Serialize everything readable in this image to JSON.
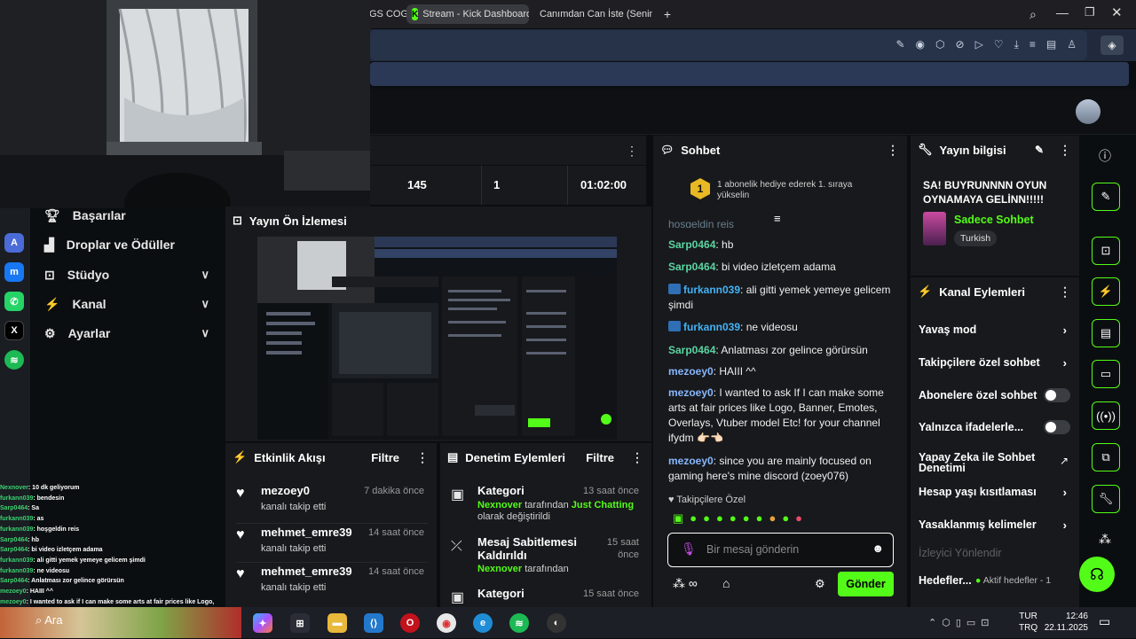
{
  "browser": {
    "tabs": [
      {
        "label": "GS COG"
      },
      {
        "label": "Stream - Kick Dashboard",
        "active": true
      },
      {
        "label": "Canımdan Can İste (Senin"
      }
    ],
    "new_tab": "+"
  },
  "stats": {
    "viewers": "145",
    "count2": "1",
    "duration": "01:02:00"
  },
  "left_nav": {
    "items": [
      {
        "label": "Başarılar",
        "icon": "trophy-icon"
      },
      {
        "label": "Droplar ve Ödüller",
        "icon": "drops-icon"
      },
      {
        "label": "Stüdyo",
        "icon": "studio-icon",
        "chevron": true
      },
      {
        "label": "Kanal",
        "icon": "channel-icon",
        "chevron": true
      },
      {
        "label": "Ayarlar",
        "icon": "gear-icon",
        "chevron": true
      }
    ]
  },
  "overlay_chat": [
    {
      "user": "Nexnover",
      "text": ": 10 dk geliyorum"
    },
    {
      "user": "furkann039",
      "text": ": bendesin"
    },
    {
      "user": "Sarp0464",
      "text": ": Sa"
    },
    {
      "user": "furkann039",
      "text": ": as"
    },
    {
      "user": "furkann039",
      "text": ": hoşgeldin reis"
    },
    {
      "user": "Sarp0464",
      "text": ": hb"
    },
    {
      "user": "Sarp0464",
      "text": ": bi video izletçem adama"
    },
    {
      "user": "furkann039",
      "text": ": ali gitti yemek yemeye gelicem şimdi"
    },
    {
      "user": "furkann039",
      "text": ": ne videosu"
    },
    {
      "user": "Sarp0464",
      "text": ": Anlatması zor gelince görürsün"
    },
    {
      "user": "mezoey0",
      "text": ": HAIII ^^"
    },
    {
      "user": "mezoey0",
      "text": ": I wanted to ask if I can make some arts at fair prices like Logo,"
    },
    {
      "user": "",
      "text": "Banner, Emotes, Overlays, Vtuber model Etc! for your channel ifydm"
    },
    {
      "user": "mezoey0",
      "text": ": since you are mainly focused on gaming here's mine discord"
    },
    {
      "user": "",
      "text": "(zoey076)"
    }
  ],
  "preview": {
    "title": "Yayın Ön İzlemesi"
  },
  "activity": {
    "title": "Etkinlik Akışı",
    "filter": "Filtre",
    "rows": [
      {
        "user": "mezoey0",
        "action": "kanalı takip etti",
        "time": "7 dakika önce"
      },
      {
        "user": "mehmet_emre39",
        "action": "kanalı takip etti",
        "time": "14 saat önce"
      },
      {
        "user": "mehmet_emre39",
        "action": "kanalı takip etti",
        "time": "14 saat önce"
      }
    ]
  },
  "moderation": {
    "title": "Denetim Eylemleri",
    "filter": "Filtre",
    "rows": [
      {
        "title": "Kategori",
        "time": "13 saat önce",
        "actor": "Nexnover",
        "mid": " tarafından ",
        "target": "Just Chatting",
        "tail": "olarak değiştirildi"
      },
      {
        "title": "Mesaj Sabitlemesi",
        "title2": "Kaldırıldı",
        "time": "15 saat",
        "time2": "önce",
        "actor": "Nexnover",
        "mid": " tarafından"
      },
      {
        "title": "Kategori",
        "time": "15 saat önce"
      }
    ]
  },
  "chat": {
    "title": "Sohbet",
    "gift_text": "1 abonelik hediye ederek 1. sıraya yükselin",
    "gift_rank": "1",
    "partial_top": "hoşgeldin reis",
    "messages": [
      {
        "user": "Sarp0464",
        "cls": "u-sarp",
        "text": ": hb"
      },
      {
        "user": "Sarp0464",
        "cls": "u-sarp",
        "text": ": bi video izletçem adama"
      },
      {
        "user": "furkann039",
        "cls": "u-furk",
        "badge": true,
        "text": ": ali gitti yemek yemeye gelicem şimdi"
      },
      {
        "user": "furkann039",
        "cls": "u-furk",
        "badge": true,
        "text": ": ne videosu"
      },
      {
        "user": "Sarp0464",
        "cls": "u-sarp",
        "text": ": Anlatması zor gelince görürsün"
      },
      {
        "user": "mezoey0",
        "cls": "u-mez",
        "text": ": HAIII ^^"
      },
      {
        "user": "mezoey0",
        "cls": "u-mez",
        "text": ": I wanted to ask If I can make some arts at fair prices like Logo, Banner, Emotes, Overlays, Vtuber model Etc! for your channel ifydm 👉🏻👈🏻"
      },
      {
        "user": "mezoey0",
        "cls": "u-mez",
        "text": ": since you are mainly focused on gaming here's mine discord (zoey076)"
      }
    ],
    "followers_only": "Takipçilere Özel",
    "input_placeholder": "Bir mesaj gönderin",
    "send": "Gönder"
  },
  "stream_info": {
    "title": "Yayın bilgisi",
    "stream_title": "SA! BUYRUNNNN OYUN OYNAMAYA GELİNN!!!!!",
    "category": "Sadece Sohbet",
    "language": "Turkish"
  },
  "channel_actions": {
    "title": "Kanal Eylemleri",
    "rows": [
      {
        "label": "Yavaş mod",
        "kind": "arrow"
      },
      {
        "label": "Takipçilere özel sohbet",
        "kind": "arrow"
      },
      {
        "label": "Abonelere özel sohbet",
        "kind": "toggle"
      },
      {
        "label": "Yalnızca ifadelerle...",
        "kind": "toggle"
      },
      {
        "label": "Yapay Zeka ile Sohbet Denetimi",
        "kind": "external"
      },
      {
        "label": "Hesap yaşı kısıtlaması",
        "kind": "arrow"
      },
      {
        "label": "Yasaklanmış kelimeler",
        "kind": "arrow"
      },
      {
        "label": "İzleyici Yönlendir",
        "kind": "disabled"
      },
      {
        "label": "Hedefler...",
        "kind": "goals",
        "extra": "Aktif hedefler - 1"
      }
    ]
  },
  "taskbar": {
    "search": "Ara",
    "lang": "TUR",
    "lang2": "TRQ",
    "time": "12:46",
    "date": "22.11.2025"
  },
  "colors": {
    "accent": "#53fc18",
    "panel": "#18191c",
    "bg": "#0b0e10"
  }
}
